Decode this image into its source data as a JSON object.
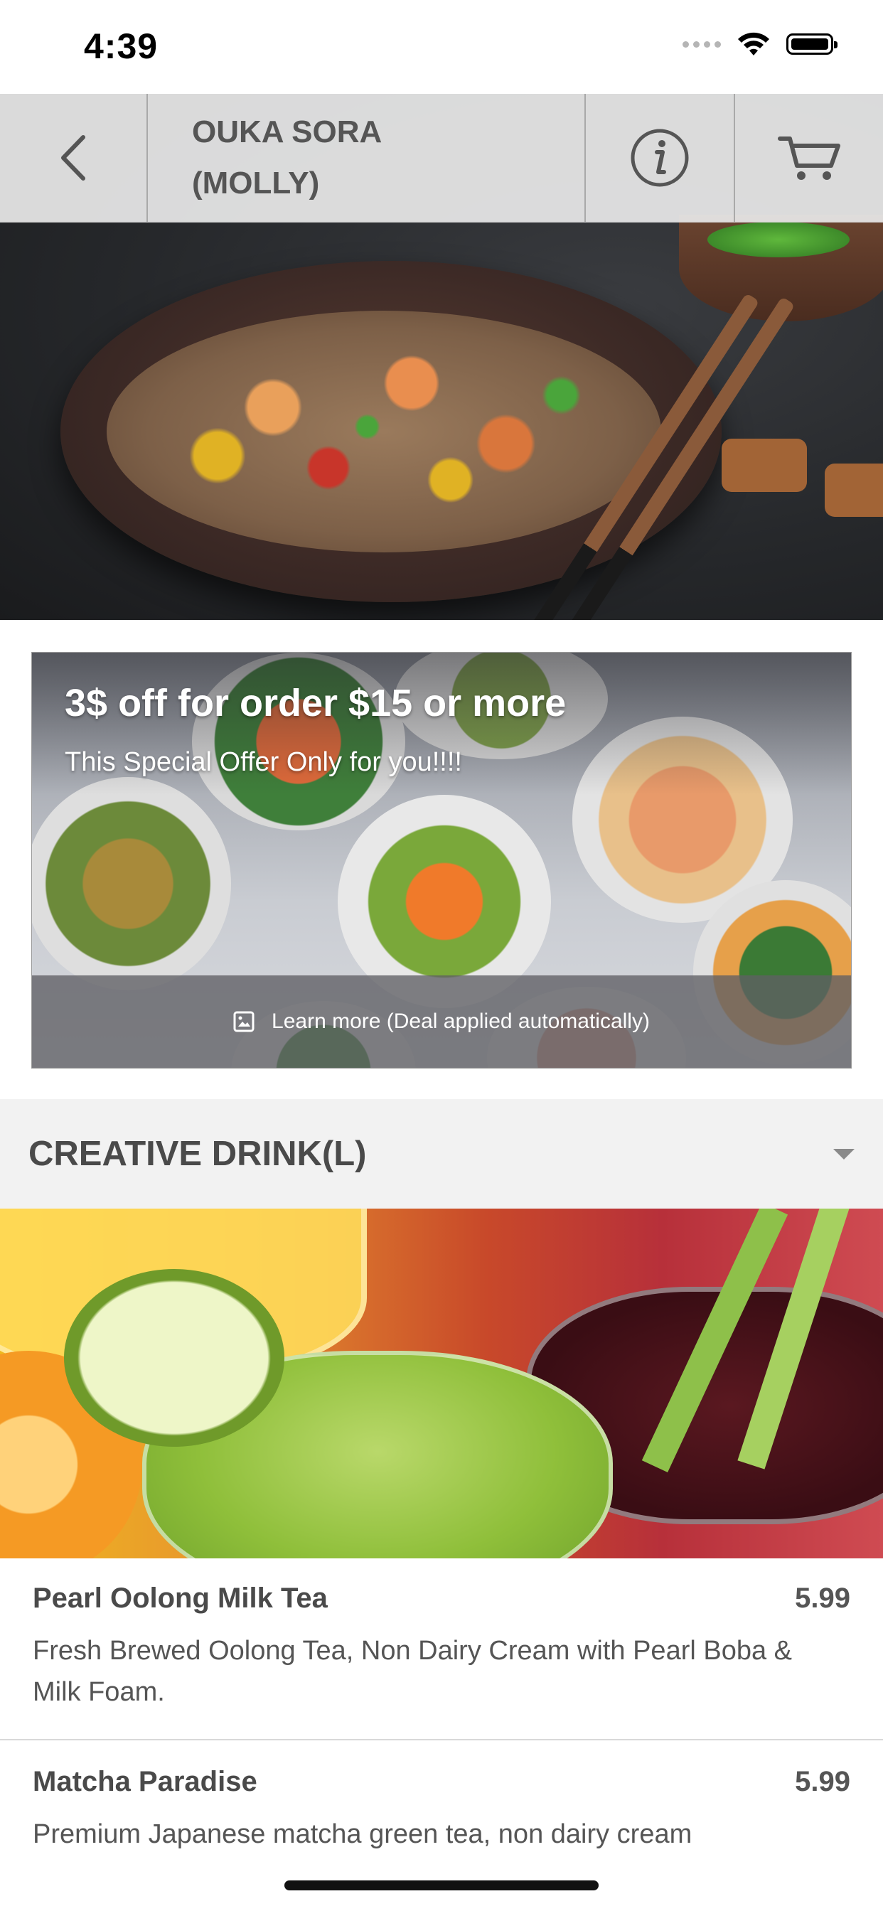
{
  "status_bar": {
    "time": "4:39"
  },
  "nav": {
    "back_icon": "chevron-left-icon",
    "title": "OUKA SORA (MOLLY)",
    "info_icon": "info-icon",
    "cart_icon": "cart-icon"
  },
  "promo": {
    "title": "3$ off for order $15 or more",
    "subtitle": "This Special Offer Only for you!!!!",
    "learn_more": "Learn more (Deal applied automatically)",
    "learn_more_icon": "image-icon"
  },
  "category": {
    "title": "CREATIVE DRINK(L)",
    "toggle_icon": "caret-down-icon"
  },
  "menu_items": [
    {
      "name": "Pearl Oolong Milk Tea",
      "price": "5.99",
      "description": "Fresh Brewed Oolong Tea, Non Dairy Cream with Pearl Boba & Milk Foam."
    },
    {
      "name": "Matcha Paradise",
      "price": "5.99",
      "description": "Premium Japanese matcha green tea, non dairy cream"
    }
  ],
  "colors": {
    "nav_bg": "#e8e8e8",
    "category_bg": "#f2f2f2",
    "text_primary": "#4a4a4a"
  }
}
